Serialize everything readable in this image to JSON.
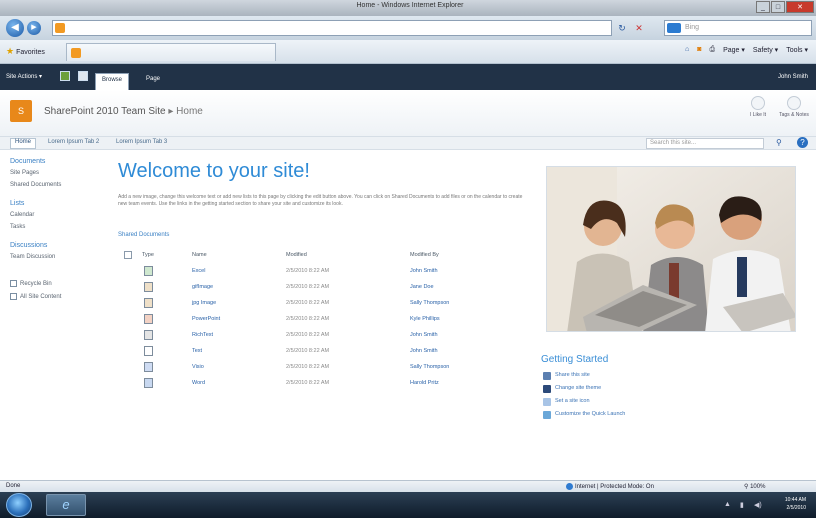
{
  "window": {
    "title": "Home - Windows Internet Explorer"
  },
  "browser": {
    "search_placeholder": "Bing",
    "favorites_label": "Favorites",
    "command_items": [
      "Page ▾",
      "Safety ▾",
      "Tools ▾"
    ]
  },
  "ribbon": {
    "site_actions": "Site Actions ▾",
    "tabs": [
      "Browse",
      "Page"
    ],
    "user": "John Smith"
  },
  "header": {
    "site_title": "SharePoint 2010 Team Site",
    "separator": "▸",
    "current_page": "Home",
    "buttons": [
      "I Like It",
      "Tags & Notes"
    ]
  },
  "topnav": {
    "items": [
      "Home",
      "Lorem Ipsum Tab 2",
      "Lorem Ipsum Tab 3"
    ],
    "search_placeholder": "Search this site..."
  },
  "quicklaunch": {
    "documents_heading": "Documents",
    "documents_items": [
      "Site Pages",
      "Shared Documents"
    ],
    "lists_heading": "Lists",
    "lists_items": [
      "Calendar",
      "Tasks"
    ],
    "discussions_heading": "Discussions",
    "discussions_items": [
      "Team Discussion"
    ],
    "recycle_bin": "Recycle Bin",
    "all_site_content": "All Site Content"
  },
  "main": {
    "welcome_title": "Welcome to your site!",
    "welcome_text": "Add a new image, change this welcome text or add new lists to this page by clicking the edit button above. You can click on Shared Documents to add files or on the calendar to create new team events. Use the links in the getting started section to share your site and customize its look.",
    "shared_docs_heading": "Shared Documents",
    "columns": {
      "type": "Type",
      "name": "Name",
      "modified": "Modified",
      "modified_by": "Modified By"
    },
    "rows": [
      {
        "name": "Excel",
        "modified": "2/5/2010 8:22 AM",
        "modified_by": "John Smith"
      },
      {
        "name": "gifImage",
        "modified": "2/5/2010 8:22 AM",
        "modified_by": "Jane Doe"
      },
      {
        "name": "jpg Image",
        "modified": "2/5/2010 8:22 AM",
        "modified_by": "Sally Thompson"
      },
      {
        "name": "PowerPoint",
        "modified": "2/5/2010 8:22 AM",
        "modified_by": "Kyle Phillips"
      },
      {
        "name": "RichText",
        "modified": "2/5/2010 8:22 AM",
        "modified_by": "John Smith"
      },
      {
        "name": "Text",
        "modified": "2/5/2010 8:22 AM",
        "modified_by": "John Smith"
      },
      {
        "name": "Visio",
        "modified": "2/5/2010 8:22 AM",
        "modified_by": "Sally Thompson"
      },
      {
        "name": "Word",
        "modified": "2/5/2010 8:22 AM",
        "modified_by": "Harold Pritz"
      }
    ]
  },
  "getting_started": {
    "title": "Getting Started",
    "items": [
      "Share this site",
      "Change site theme",
      "Set a site icon",
      "Customize the Quick Launch"
    ]
  },
  "status": {
    "left": "Done",
    "zone": "Internet | Protected Mode: On",
    "zoom": "100%"
  },
  "taskbar": {
    "time": "10:44 AM",
    "date": "2/5/2010"
  },
  "colors": {
    "ribbon": "#213247",
    "accent": "#2f8bd6",
    "sharepoint_orange": "#e8881a"
  }
}
